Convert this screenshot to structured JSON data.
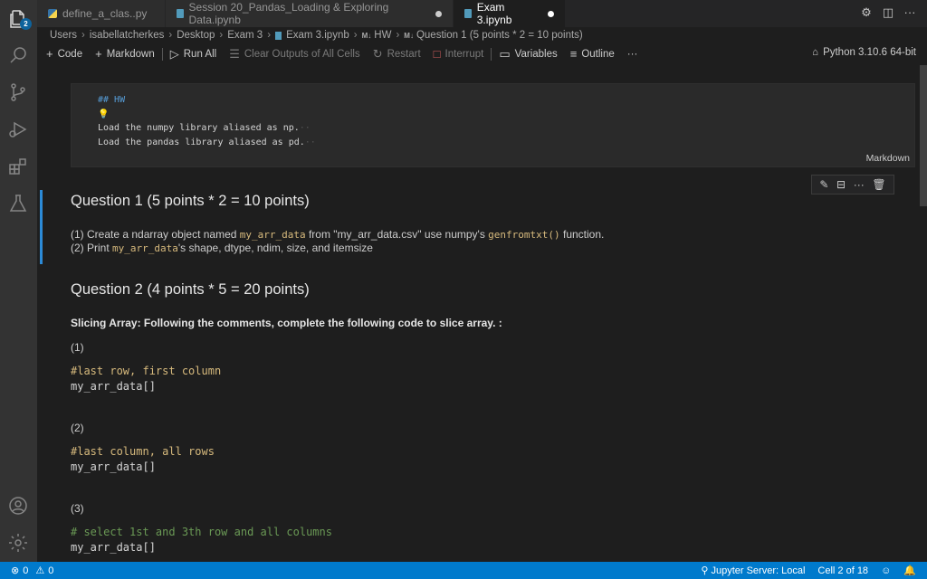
{
  "activity_bar": {
    "badge": "2",
    "icons": [
      "explorer-icon",
      "search-icon",
      "source-control-icon",
      "run-debug-icon",
      "extensions-icon",
      "testing-icon",
      "account-icon",
      "settings-gear-icon"
    ]
  },
  "tabs": [
    {
      "label": "define_a_clas..py",
      "modified": false,
      "active": false
    },
    {
      "label": "Session 20_Pandas_Loading & Exploring Data.ipynb",
      "modified": true,
      "active": false
    },
    {
      "label": "Exam 3.ipynb",
      "modified": true,
      "active": true
    }
  ],
  "breadcrumb": {
    "items": [
      "Users",
      "isabellatcherkes",
      "Desktop",
      "Exam 3",
      "Exam 3.ipynb",
      "HW",
      "Question 1 (5 points * 2 = 10 points)"
    ],
    "md_prefix": "M↓"
  },
  "toolbar": {
    "code": "Code",
    "markdown": "Markdown",
    "run_all": "Run All",
    "clear_outputs": "Clear Outputs of All Cells",
    "restart": "Restart",
    "interrupt": "Interrupt",
    "variables": "Variables",
    "outline": "Outline",
    "more": "···",
    "kernel": "Python 3.10.6 64-bit"
  },
  "edit_cell": {
    "line1": "## HW",
    "line3": "Load the numpy library aliased as np.",
    "line4": "Load the pandas library aliased as pd.",
    "lang": "Markdown"
  },
  "q1": {
    "title": "Question 1 (5 points * 2 = 10 points)",
    "l1_a": "(1) Create a ndarray object named ",
    "l1_code": "my_arr_data",
    "l1_b": " from \"my_arr_data.csv\" use numpy's ",
    "l1_code2": "genfromtxt()",
    "l1_c": " function.",
    "l2_a": "(2) Print ",
    "l2_code": "my_arr_data",
    "l2_b": "'s shape, dtype, ndim, size, and itemsize"
  },
  "q2": {
    "title": "Question 2 (4 points * 5 = 20 points)",
    "subtitle": "Slicing Array: Following the comments, complete the following code to slice array. :",
    "parts": [
      {
        "label": "(1)",
        "comment": "#last row, first column",
        "code": "my_arr_data[]"
      },
      {
        "label": "(2)",
        "comment": "#last column, all rows",
        "code": "my_arr_data[]"
      },
      {
        "label": "(3)",
        "comment": "# select 1st and 3th row and all columns",
        "code": "my_arr_data[]"
      }
    ]
  },
  "statusbar": {
    "errors": "0",
    "warnings": "0",
    "jupyter": "Jupyter Server: Local",
    "cell": "Cell 2 of 18"
  }
}
